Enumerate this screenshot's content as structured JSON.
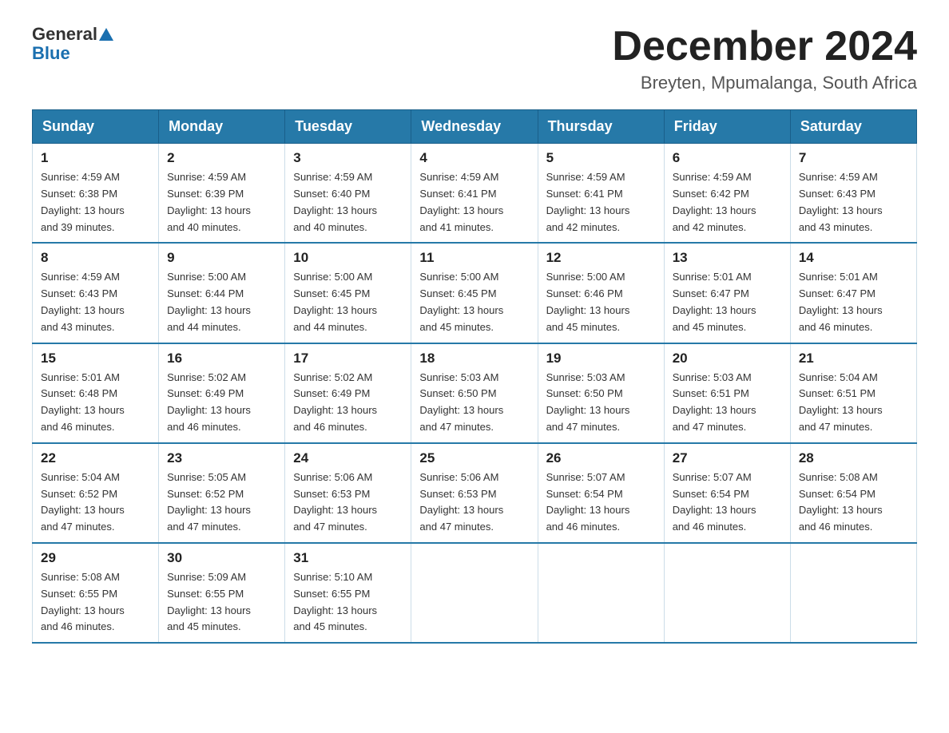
{
  "header": {
    "logo_general": "General",
    "logo_blue": "Blue",
    "month_year": "December 2024",
    "location": "Breyten, Mpumalanga, South Africa"
  },
  "columns": [
    "Sunday",
    "Monday",
    "Tuesday",
    "Wednesday",
    "Thursday",
    "Friday",
    "Saturday"
  ],
  "weeks": [
    [
      {
        "day": "1",
        "sunrise": "4:59 AM",
        "sunset": "6:38 PM",
        "daylight": "13 hours and 39 minutes."
      },
      {
        "day": "2",
        "sunrise": "4:59 AM",
        "sunset": "6:39 PM",
        "daylight": "13 hours and 40 minutes."
      },
      {
        "day": "3",
        "sunrise": "4:59 AM",
        "sunset": "6:40 PM",
        "daylight": "13 hours and 40 minutes."
      },
      {
        "day": "4",
        "sunrise": "4:59 AM",
        "sunset": "6:41 PM",
        "daylight": "13 hours and 41 minutes."
      },
      {
        "day": "5",
        "sunrise": "4:59 AM",
        "sunset": "6:41 PM",
        "daylight": "13 hours and 42 minutes."
      },
      {
        "day": "6",
        "sunrise": "4:59 AM",
        "sunset": "6:42 PM",
        "daylight": "13 hours and 42 minutes."
      },
      {
        "day": "7",
        "sunrise": "4:59 AM",
        "sunset": "6:43 PM",
        "daylight": "13 hours and 43 minutes."
      }
    ],
    [
      {
        "day": "8",
        "sunrise": "4:59 AM",
        "sunset": "6:43 PM",
        "daylight": "13 hours and 43 minutes."
      },
      {
        "day": "9",
        "sunrise": "5:00 AM",
        "sunset": "6:44 PM",
        "daylight": "13 hours and 44 minutes."
      },
      {
        "day": "10",
        "sunrise": "5:00 AM",
        "sunset": "6:45 PM",
        "daylight": "13 hours and 44 minutes."
      },
      {
        "day": "11",
        "sunrise": "5:00 AM",
        "sunset": "6:45 PM",
        "daylight": "13 hours and 45 minutes."
      },
      {
        "day": "12",
        "sunrise": "5:00 AM",
        "sunset": "6:46 PM",
        "daylight": "13 hours and 45 minutes."
      },
      {
        "day": "13",
        "sunrise": "5:01 AM",
        "sunset": "6:47 PM",
        "daylight": "13 hours and 45 minutes."
      },
      {
        "day": "14",
        "sunrise": "5:01 AM",
        "sunset": "6:47 PM",
        "daylight": "13 hours and 46 minutes."
      }
    ],
    [
      {
        "day": "15",
        "sunrise": "5:01 AM",
        "sunset": "6:48 PM",
        "daylight": "13 hours and 46 minutes."
      },
      {
        "day": "16",
        "sunrise": "5:02 AM",
        "sunset": "6:49 PM",
        "daylight": "13 hours and 46 minutes."
      },
      {
        "day": "17",
        "sunrise": "5:02 AM",
        "sunset": "6:49 PM",
        "daylight": "13 hours and 46 minutes."
      },
      {
        "day": "18",
        "sunrise": "5:03 AM",
        "sunset": "6:50 PM",
        "daylight": "13 hours and 47 minutes."
      },
      {
        "day": "19",
        "sunrise": "5:03 AM",
        "sunset": "6:50 PM",
        "daylight": "13 hours and 47 minutes."
      },
      {
        "day": "20",
        "sunrise": "5:03 AM",
        "sunset": "6:51 PM",
        "daylight": "13 hours and 47 minutes."
      },
      {
        "day": "21",
        "sunrise": "5:04 AM",
        "sunset": "6:51 PM",
        "daylight": "13 hours and 47 minutes."
      }
    ],
    [
      {
        "day": "22",
        "sunrise": "5:04 AM",
        "sunset": "6:52 PM",
        "daylight": "13 hours and 47 minutes."
      },
      {
        "day": "23",
        "sunrise": "5:05 AM",
        "sunset": "6:52 PM",
        "daylight": "13 hours and 47 minutes."
      },
      {
        "day": "24",
        "sunrise": "5:06 AM",
        "sunset": "6:53 PM",
        "daylight": "13 hours and 47 minutes."
      },
      {
        "day": "25",
        "sunrise": "5:06 AM",
        "sunset": "6:53 PM",
        "daylight": "13 hours and 47 minutes."
      },
      {
        "day": "26",
        "sunrise": "5:07 AM",
        "sunset": "6:54 PM",
        "daylight": "13 hours and 46 minutes."
      },
      {
        "day": "27",
        "sunrise": "5:07 AM",
        "sunset": "6:54 PM",
        "daylight": "13 hours and 46 minutes."
      },
      {
        "day": "28",
        "sunrise": "5:08 AM",
        "sunset": "6:54 PM",
        "daylight": "13 hours and 46 minutes."
      }
    ],
    [
      {
        "day": "29",
        "sunrise": "5:08 AM",
        "sunset": "6:55 PM",
        "daylight": "13 hours and 46 minutes."
      },
      {
        "day": "30",
        "sunrise": "5:09 AM",
        "sunset": "6:55 PM",
        "daylight": "13 hours and 45 minutes."
      },
      {
        "day": "31",
        "sunrise": "5:10 AM",
        "sunset": "6:55 PM",
        "daylight": "13 hours and 45 minutes."
      },
      null,
      null,
      null,
      null
    ]
  ],
  "labels": {
    "sunrise": "Sunrise:",
    "sunset": "Sunset:",
    "daylight": "Daylight:"
  }
}
